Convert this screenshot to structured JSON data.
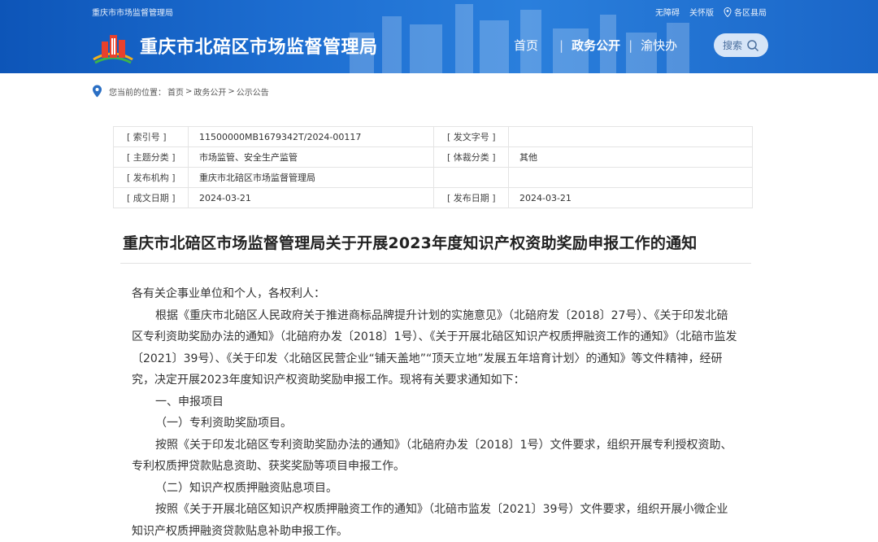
{
  "header": {
    "top_left": "重庆市市场监督管理局",
    "top_links": [
      "无障碍",
      "关怀版",
      "各区县局"
    ],
    "site_title": "重庆市北碚区市场监督管理局",
    "nav": [
      "首页",
      "政务公开",
      "渝快办"
    ],
    "search_label": "搜索"
  },
  "breadcrumb": {
    "prefix": "您当前的位置：",
    "items": [
      "首页",
      "政务公开",
      "公示公告"
    ],
    "separator": ">"
  },
  "meta": [
    {
      "k1": "[ 索引号 ]",
      "v1": "11500000MB1679342T/2024-00117",
      "k2": "[ 发文字号 ]",
      "v2": ""
    },
    {
      "k1": "[ 主题分类 ]",
      "v1": "市场监管、安全生产监管",
      "k2": "[ 体裁分类 ]",
      "v2": "其他"
    },
    {
      "k1": "[ 发布机构 ]",
      "v1": "重庆市北碚区市场监督管理局",
      "k2": "",
      "v2": ""
    },
    {
      "k1": "[ 成文日期 ]",
      "v1": "2024-03-21",
      "k2": "[ 发布日期 ]",
      "v2": "2024-03-21"
    }
  ],
  "article": {
    "title": "重庆市北碚区市场监督管理局关于开展2023年度知识产权资助奖励申报工作的通知",
    "lines": [
      {
        "text": "各有关企事业单位和个人，各权利人：",
        "indent": false
      },
      {
        "text": "根据《重庆市北碚区人民政府关于推进商标品牌提升计划的实施意见》（北碚府发〔2018〕27号）、《关于印发北碚区专利资助奖励办法的通知》（北碚府办发〔2018〕1号）、《关于开展北碚区知识产权质押融资工作的通知》（北碚市监发〔2021〕39号）、《关于印发〈北碚区民营企业“铺天盖地”“顶天立地”发展五年培育计划〉的通知》等文件精神，经研究，决定开展2023年度知识产权资助奖励申报工作。现将有关要求通知如下：",
        "indent": true
      },
      {
        "text": "一、申报项目",
        "indent": true
      },
      {
        "text": "（一）专利资助奖励项目。",
        "indent": true
      },
      {
        "text": "按照《关于印发北碚区专利资助奖励办法的通知》（北碚府办发〔2018〕1号）文件要求，组织开展专利授权资助、专利权质押贷款贴息资助、获奖奖励等项目申报工作。",
        "indent": true
      },
      {
        "text": "（二）知识产权质押融资贴息项目。",
        "indent": true
      },
      {
        "text": "按照《关于开展北碚区知识产权质押融资工作的通知》（北碚市监发〔2021〕39号）文件要求，组织开展小微企业知识产权质押融资贷款贴息补助申报工作。",
        "indent": true
      }
    ]
  }
}
